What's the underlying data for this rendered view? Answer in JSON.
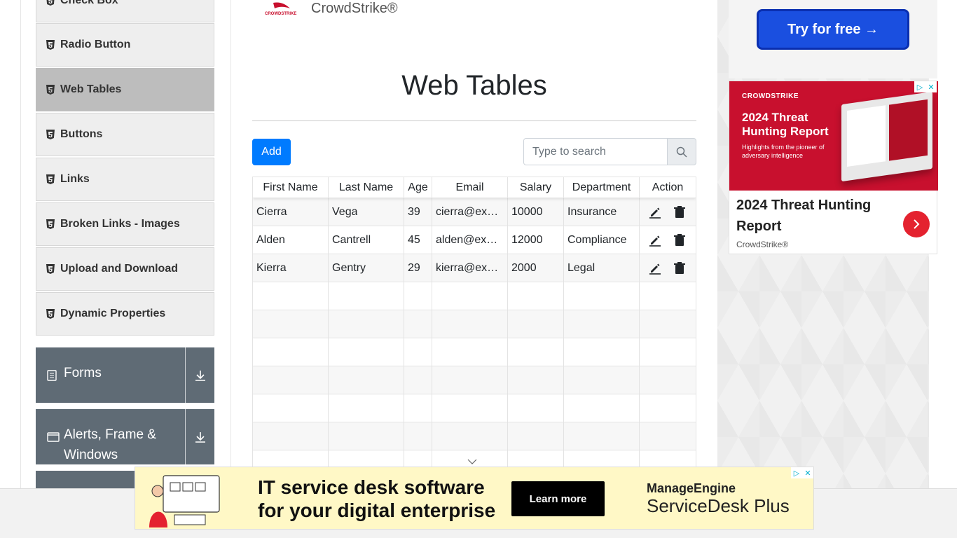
{
  "sidebar": {
    "items": [
      {
        "label": "Check Box",
        "active": false
      },
      {
        "label": "Radio Button",
        "active": false
      },
      {
        "label": "Web Tables",
        "active": true
      },
      {
        "label": "Buttons",
        "active": false
      },
      {
        "label": "Links",
        "active": false
      },
      {
        "label": "Broken Links - Images",
        "active": false
      },
      {
        "label": "Upload and Download",
        "active": false
      },
      {
        "label": "Dynamic Properties",
        "active": false
      }
    ],
    "groups": [
      {
        "label": "Forms"
      },
      {
        "label": "Alerts, Frame & Windows"
      }
    ]
  },
  "brand": {
    "name": "CrowdStrike®",
    "logo_text": "CROWDSTRIKE"
  },
  "page": {
    "title": "Web Tables"
  },
  "toolbar": {
    "add_label": "Add",
    "search_placeholder": "Type to search"
  },
  "table": {
    "columns": [
      "First Name",
      "Last Name",
      "Age",
      "Email",
      "Salary",
      "Department",
      "Action"
    ],
    "rows": [
      {
        "first": "Cierra",
        "last": "Vega",
        "age": "39",
        "email": "cierra@ex…",
        "salary": "10000",
        "dept": "Insurance"
      },
      {
        "first": "Alden",
        "last": "Cantrell",
        "age": "45",
        "email": "alden@ex…",
        "salary": "12000",
        "dept": "Compliance"
      },
      {
        "first": "Kierra",
        "last": "Gentry",
        "age": "29",
        "email": "kierra@ex…",
        "salary": "2000",
        "dept": "Legal"
      }
    ],
    "empty_rows": 7
  },
  "ads": {
    "top_cta": "Try for free →",
    "card_brand": "CROWDSTRIKE",
    "card_image_title": "2024 Threat Hunting Report",
    "card_image_sub": "Highlights from the pioneer of adversary intelligence",
    "card_title": "2024 Threat Hunting Report",
    "card_source": "CrowdStrike®",
    "banner_line1": "IT service desk software",
    "banner_line2": "for your digital enterprise",
    "banner_cta": "Learn more",
    "banner_brand": "ManageEngine",
    "banner_product": "ServiceDesk Plus"
  },
  "colors": {
    "primary": "#007bff",
    "sidebar_group": "#5f6b75",
    "active_item": "#bdbdbd",
    "crowdstrike_red": "#c8102e"
  }
}
